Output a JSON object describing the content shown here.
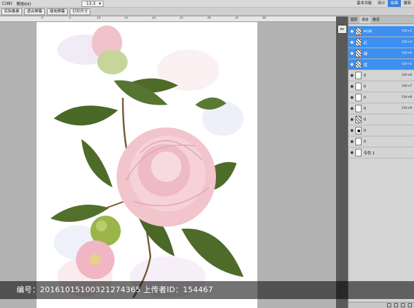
{
  "menubar": {
    "items": [
      "C(W)",
      "帮助(H)"
    ],
    "zoom": "13.3",
    "workspace_tabs": [
      "基本功能",
      "设计",
      "绘画",
      "摄影"
    ],
    "active_workspace": "绘画"
  },
  "toolbar": {
    "buttons": [
      "实际像素",
      "适合屏幕",
      "填充屏幕",
      "打印尺寸"
    ]
  },
  "ruler": {
    "labels": [
      "0",
      "5",
      "10",
      "15",
      "20",
      "25",
      "30",
      "35",
      "40"
    ]
  },
  "panel": {
    "tabs": [
      "图层",
      "通道",
      "路径"
    ],
    "active_tab": "通道",
    "rows": [
      {
        "name": "RGB",
        "shortcut": "Ctrl+2",
        "selected": true,
        "thumb": "art"
      },
      {
        "name": "红",
        "shortcut": "Ctrl+3",
        "selected": true,
        "thumb": "art"
      },
      {
        "name": "绿",
        "shortcut": "Ctrl+4",
        "selected": true,
        "thumb": "art"
      },
      {
        "name": "蓝",
        "shortcut": "Ctrl+5",
        "selected": true,
        "thumb": "art"
      },
      {
        "name": "0",
        "shortcut": "Ctrl+6",
        "selected": false,
        "thumb": "blank"
      },
      {
        "name": "0",
        "shortcut": "Ctrl+7",
        "selected": false,
        "thumb": "blank"
      },
      {
        "name": "0",
        "shortcut": "Ctrl+8",
        "selected": false,
        "thumb": "blank"
      },
      {
        "name": "0",
        "shortcut": "Ctrl+9",
        "selected": false,
        "thumb": "blank"
      },
      {
        "name": "0",
        "shortcut": "",
        "selected": false,
        "thumb": "art"
      },
      {
        "name": "0",
        "shortcut": "",
        "selected": false,
        "thumb": "dark"
      },
      {
        "name": "0",
        "shortcut": "",
        "selected": false,
        "thumb": "blank"
      },
      {
        "name": "专色 1",
        "shortcut": "",
        "selected": false,
        "thumb": "blank"
      }
    ]
  },
  "watermark": {
    "text": "编号：20161015100321274365 上传者ID：154467"
  },
  "colors": {
    "selection": "#3d8ff0",
    "petal": "#f2c4cc",
    "leaf": "#4f6b2a"
  }
}
